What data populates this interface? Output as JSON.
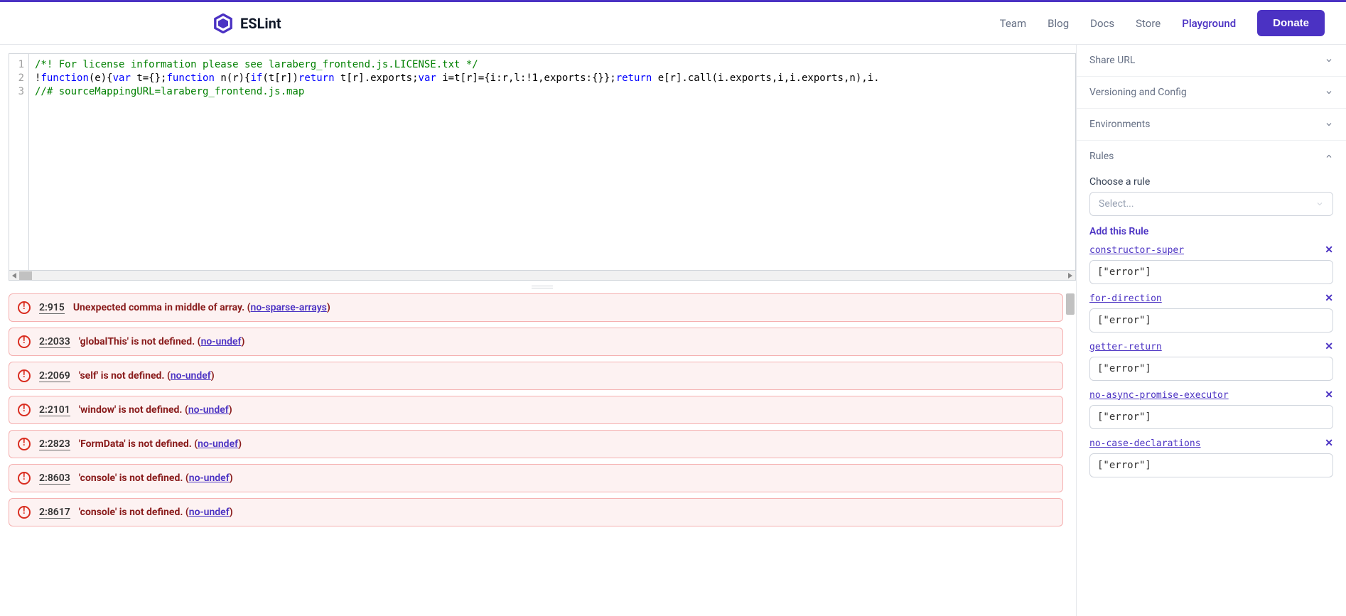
{
  "brand": "ESLint",
  "nav": {
    "team": "Team",
    "blog": "Blog",
    "docs": "Docs",
    "store": "Store",
    "playground": "Playground",
    "donate": "Donate"
  },
  "editor": {
    "lines": [
      "1",
      "2",
      "3"
    ],
    "line1": "/*! For license information please see laraberg_frontend.js.LICENSE.txt */",
    "line2_parts": {
      "a": "!",
      "b": "function",
      "c": "(e){",
      "d": "var",
      "e": " t={};",
      "f": "function",
      "g": " n(r){",
      "h": "if",
      "i": "(t[r])",
      "j": "return",
      "k": " t[r].exports;",
      "l": "var",
      "m": " i=t[r]={i:r,l:!1,exports:{}};",
      "n": "return",
      "o": " e[r].call(i.exports,i,i.exports,n),i."
    },
    "line3": "//# sourceMappingURL=laraberg_frontend.js.map"
  },
  "errors": [
    {
      "loc": "2:915",
      "msg": "Unexpected comma in middle of array.",
      "rule": "no-sparse-arrays"
    },
    {
      "loc": "2:2033",
      "msg": "'globalThis' is not defined.",
      "rule": "no-undef"
    },
    {
      "loc": "2:2069",
      "msg": "'self' is not defined.",
      "rule": "no-undef"
    },
    {
      "loc": "2:2101",
      "msg": "'window' is not defined.",
      "rule": "no-undef"
    },
    {
      "loc": "2:2823",
      "msg": "'FormData' is not defined.",
      "rule": "no-undef"
    },
    {
      "loc": "2:8603",
      "msg": "'console' is not defined.",
      "rule": "no-undef"
    },
    {
      "loc": "2:8617",
      "msg": "'console' is not defined.",
      "rule": "no-undef"
    }
  ],
  "sidebar": {
    "share": "Share URL",
    "versioning": "Versioning and Config",
    "environments": "Environments",
    "rules_title": "Rules",
    "choose_label": "Choose a rule",
    "select_placeholder": "Select...",
    "add_rule": "Add this Rule",
    "rules": [
      {
        "name": "constructor-super",
        "value": "[\"error\"]"
      },
      {
        "name": "for-direction",
        "value": "[\"error\"]"
      },
      {
        "name": "getter-return",
        "value": "[\"error\"]"
      },
      {
        "name": "no-async-promise-executor",
        "value": "[\"error\"]"
      },
      {
        "name": "no-case-declarations",
        "value": "[\"error\"]"
      }
    ]
  }
}
